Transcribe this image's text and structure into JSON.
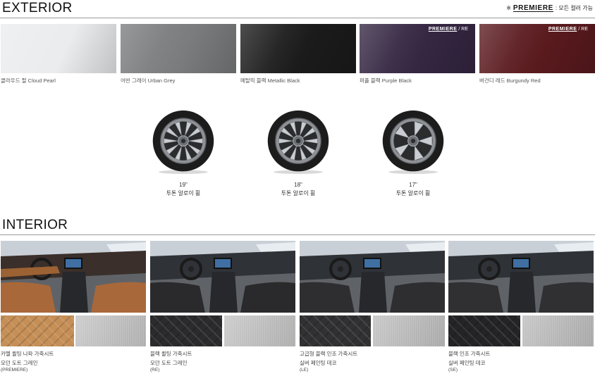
{
  "exterior": {
    "title": "EXTERIOR",
    "note": {
      "mark": "※",
      "logo": "PREMIERE",
      "text": ": 모든 컬러 가능"
    },
    "colors": [
      {
        "name": "클라우드 펄 Cloud Pearl",
        "color": "#eaecee",
        "badge": ""
      },
      {
        "name": "어반 그레이 Urban Grey",
        "color": "#7a7c7e",
        "badge": ""
      },
      {
        "name": "메탈릭 블랙 Metallic Black",
        "color": "#1b1b1c",
        "badge": ""
      },
      {
        "name": "퍼플 블랙 Purple Black",
        "color": "#352642",
        "badge": "PREMIERE",
        "badge_suffix": "/ RE"
      },
      {
        "name": "버건디 레드 Burgundy Red",
        "color": "#5a1a1e",
        "badge": "PREMIERE",
        "badge_suffix": "/ RE"
      }
    ],
    "wheels": [
      {
        "size": "19\"",
        "name": "투톤 알로이 휠"
      },
      {
        "size": "18\"",
        "name": "투톤 알로이 휠"
      },
      {
        "size": "17\"",
        "name": "투톤 알로이 휠"
      }
    ]
  },
  "interior": {
    "title": "INTERIOR",
    "trims": [
      {
        "line1": "카멜 퀼팅 나파 가죽시트",
        "line2": "모던 도트 그레인",
        "line3": "(PREMIERE)",
        "seat_color": "#a9683a",
        "mat_color": "#c58f57",
        "grain_color": "#bdbdbd"
      },
      {
        "line1": "블랙 퀼팅 가죽시트",
        "line2": "모던 도트 그레인",
        "line3": "(RE)",
        "seat_color": "#2a2a2c",
        "mat_color": "#2b2b2d",
        "grain_color": "#bcbcbc"
      },
      {
        "line1": "고급형 블랙 인조 가죽시트",
        "line2": "실버 페인팅 데코",
        "line3": "(LE)",
        "seat_color": "#2e2e30",
        "mat_color": "#313133",
        "grain_color": "#b7b7b7"
      },
      {
        "line1": "블랙 인조 가죽시트",
        "line2": "실버 페인팅 데코",
        "line3": "(SE)",
        "seat_color": "#303032",
        "mat_color": "#242426",
        "grain_color": "#b5b5b5"
      }
    ]
  }
}
